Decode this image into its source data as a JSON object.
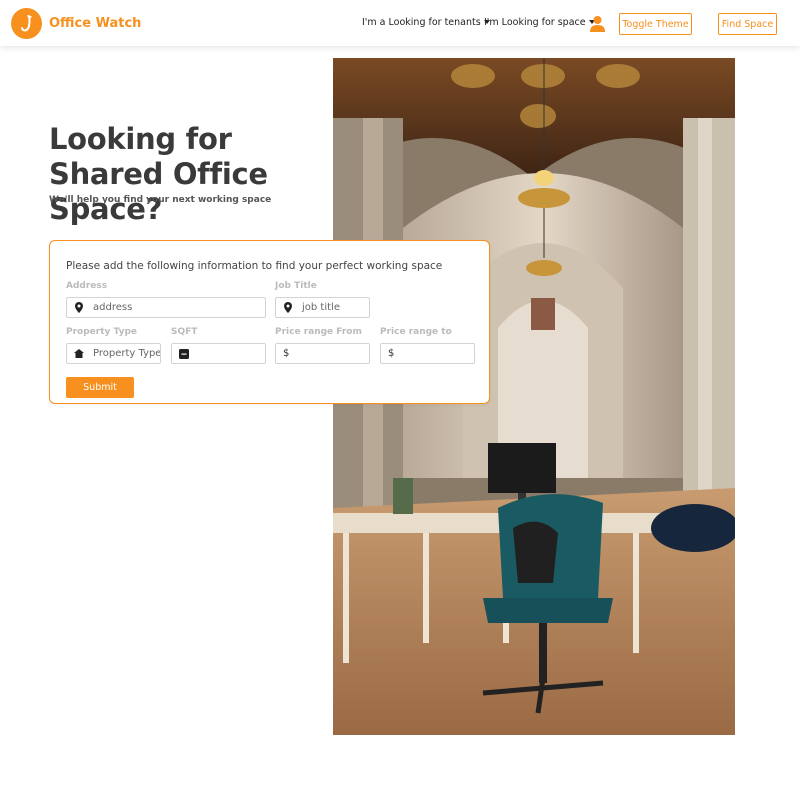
{
  "brand": {
    "name": "Office Watch",
    "accent": "#f7901e"
  },
  "nav": {
    "tenants_label": "I'm a Looking for tenants",
    "space_label": "I'm Looking for space",
    "toggle_theme": "Toggle Theme",
    "find_space": "Find Space"
  },
  "hero": {
    "title": "Looking for Shared Office Space?",
    "subtitle": "We'll help you find your next working space"
  },
  "form": {
    "heading": "Please add the following information to find your perfect working space",
    "address": {
      "label": "Address",
      "placeholder": "address",
      "icon": "map-marker-icon"
    },
    "job_title": {
      "label": "Job Title",
      "placeholder": "job title",
      "icon": "map-marker-icon"
    },
    "property_type": {
      "label": "Property Type",
      "placeholder": "Property Type",
      "icon": "building-icon"
    },
    "sqft": {
      "label": "SQFT",
      "value": "",
      "icon": "square-icon"
    },
    "price_from": {
      "label": "Price range From",
      "prefix": "$"
    },
    "price_to": {
      "label": "Price range to",
      "prefix": "$"
    },
    "submit": "Submit"
  }
}
